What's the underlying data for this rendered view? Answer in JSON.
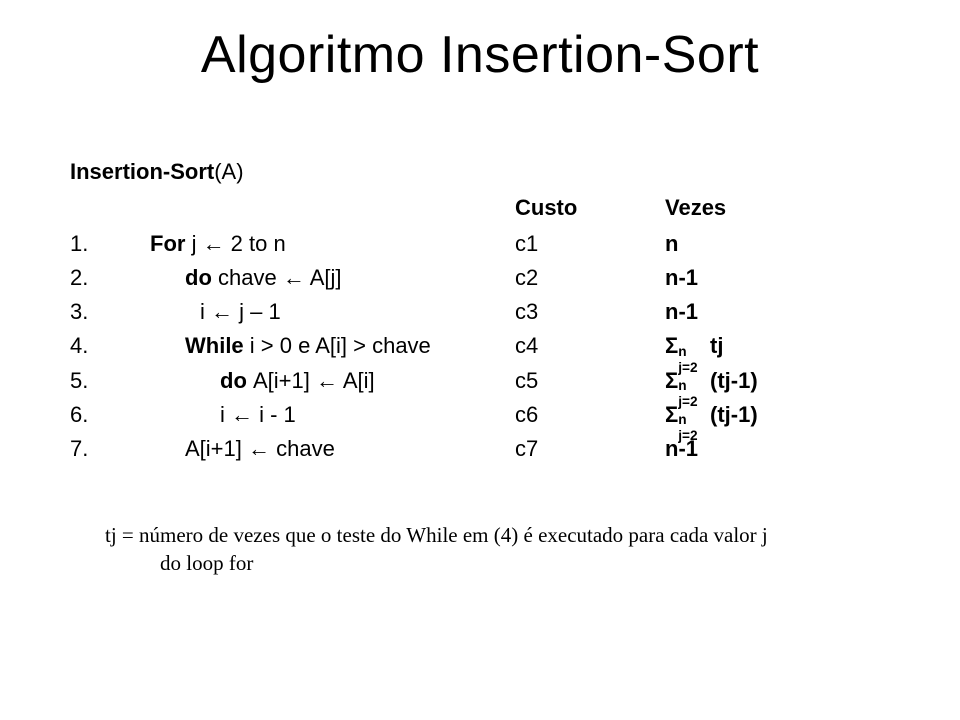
{
  "title": "Algoritmo Insertion-Sort",
  "proc_name": "Insertion-Sort",
  "proc_arg": "(A)",
  "header": {
    "cost": "Custo",
    "times": "Vezes"
  },
  "arrow": "←",
  "sigma": "Σ",
  "rows": [
    {
      "n": "1.",
      "indent": 0,
      "pre_bold": "For ",
      "code": "j ← 2 to n",
      "cost": "c1",
      "times_plain": "n"
    },
    {
      "n": "2.",
      "indent": 1,
      "pre_bold": "do ",
      "code": "chave ← A[j]",
      "cost": "c2",
      "times_plain": "n-1"
    },
    {
      "n": "3.",
      "indent": 2,
      "pre_bold": "",
      "code": "i ← j – 1",
      "cost": "c3",
      "times_plain": "n-1"
    },
    {
      "n": "4.",
      "indent": 1,
      "pre_bold": "While ",
      "code": "i > 0 e A[i] > chave",
      "cost": "c4",
      "times_sigma_tail": "tj"
    },
    {
      "n": "5.",
      "indent": 3,
      "pre_bold": "do ",
      "code": "A[i+1] ← A[i]",
      "cost": "c5",
      "times_sigma_tail": "(tj-1)"
    },
    {
      "n": "6.",
      "indent": 3,
      "pre_bold": "",
      "code": "i ← i - 1",
      "cost": "c6",
      "times_sigma_tail": "(tj-1)"
    },
    {
      "n": "7.",
      "indent": 1,
      "pre_bold": "",
      "code": "A[i+1] ← chave",
      "cost": "c7",
      "times_plain": "n-1"
    }
  ],
  "sigma_sup": "n",
  "sigma_sub": "j=2",
  "footnote_line1": "tj = número de vezes que o teste do While em (4) é executado para cada valor j",
  "footnote_line2": "do loop for"
}
